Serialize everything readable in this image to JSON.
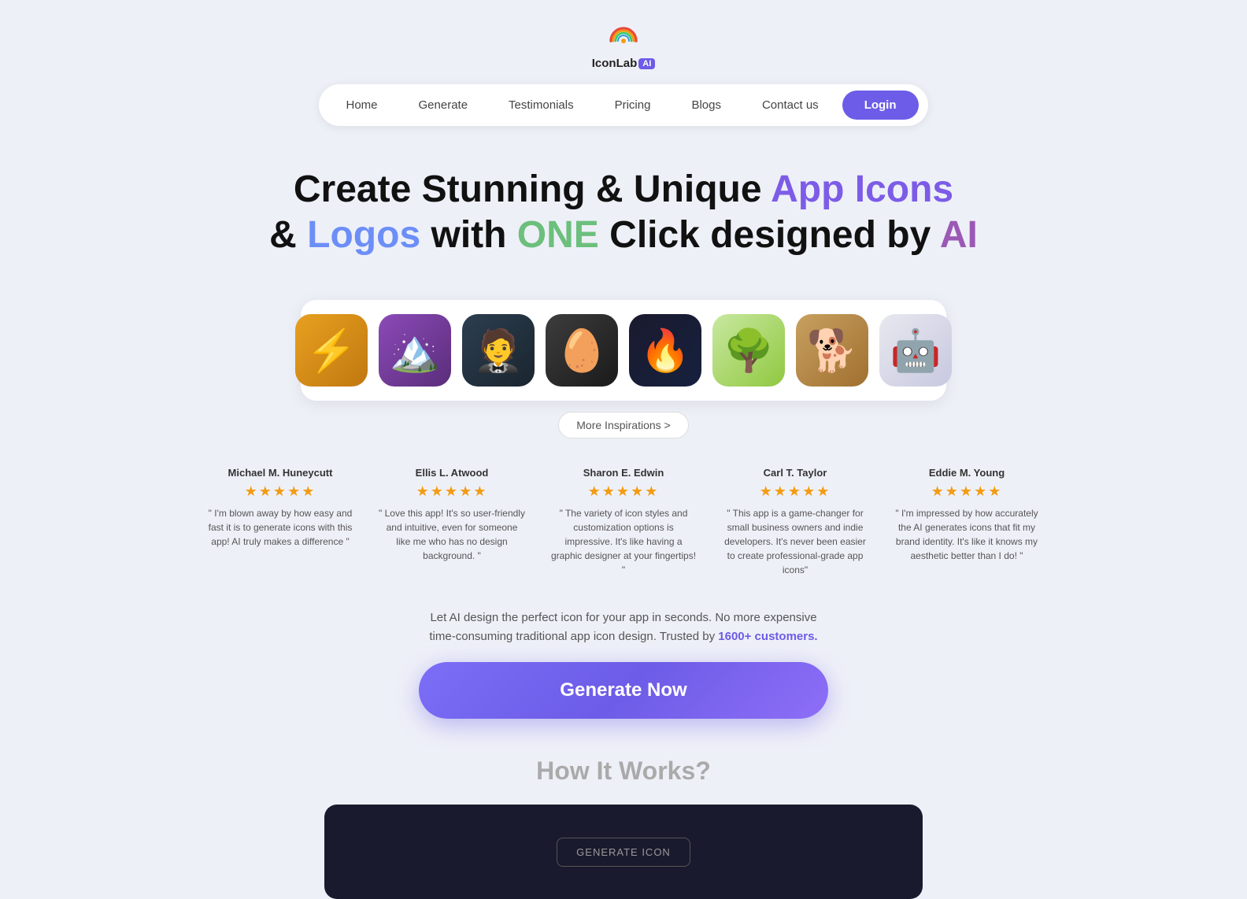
{
  "header": {
    "logo_name": "IconLab",
    "logo_badge": "AI",
    "nav": {
      "items": [
        {
          "id": "home",
          "label": "Home"
        },
        {
          "id": "generate",
          "label": "Generate"
        },
        {
          "id": "testimonials",
          "label": "Testimonials"
        },
        {
          "id": "pricing",
          "label": "Pricing"
        },
        {
          "id": "blogs",
          "label": "Blogs"
        },
        {
          "id": "contact",
          "label": "Contact us"
        }
      ],
      "login_label": "Login"
    }
  },
  "hero": {
    "title_part1": "Create Stunning & Unique ",
    "title_highlight1": "App Icons",
    "title_part2": "& ",
    "title_highlight2": "Logos",
    "title_part3": " with ",
    "title_highlight3": "ONE",
    "title_part4": " Click designed by ",
    "title_highlight4": "AI"
  },
  "icon_showcase": {
    "icons": [
      {
        "id": "icon-1",
        "emoji": "⚡",
        "label": "Pikachu icon"
      },
      {
        "id": "icon-2",
        "emoji": "🏔️",
        "label": "Mountain icon"
      },
      {
        "id": "icon-3",
        "emoji": "🤵",
        "label": "Suit icon"
      },
      {
        "id": "icon-4",
        "emoji": "🥚",
        "label": "Egg icon"
      },
      {
        "id": "icon-5",
        "emoji": "🔥",
        "label": "Fire icon"
      },
      {
        "id": "icon-6",
        "emoji": "🌳",
        "label": "Tree icon"
      },
      {
        "id": "icon-7",
        "emoji": "🐕",
        "label": "Dog icon"
      },
      {
        "id": "icon-8",
        "emoji": "🤖",
        "label": "Robot icon"
      }
    ],
    "more_button": "More Inspirations >"
  },
  "testimonials": [
    {
      "id": "t1",
      "name": "Michael M. Huneycutt",
      "stars": "★★★★★",
      "text": "\" I'm blown away by how easy and fast it is to generate icons with this app! AI truly makes a difference \""
    },
    {
      "id": "t2",
      "name": "Ellis L. Atwood",
      "stars": "★★★★★",
      "text": "\" Love this app! It's so user-friendly and intuitive, even for someone like me who has no design background. \""
    },
    {
      "id": "t3",
      "name": "Sharon E. Edwin",
      "stars": "★★★★★",
      "text": "\" The variety of icon styles and customization options is impressive. It's like having a graphic designer at your fingertips! \""
    },
    {
      "id": "t4",
      "name": "Carl T. Taylor",
      "stars": "★★★★★",
      "text": "\" This app is a game-changer for small business owners and indie developers. It's never been easier to create professional-grade app icons\""
    },
    {
      "id": "t5",
      "name": "Eddie M. Young",
      "stars": "★★★★★",
      "text": "\" I'm impressed by how accurately the AI generates icons that fit my brand identity. It's like it knows my aesthetic better than I do! \""
    }
  ],
  "cta": {
    "subtitle_part1": "Let AI design the perfect icon for your app in seconds. No more expensive",
    "subtitle_part2": "time-consuming traditional app icon design. Trusted by ",
    "subtitle_highlight": "1600+ customers.",
    "button_label": "Generate Now"
  },
  "how_it_works": {
    "title": "How It Works?",
    "generate_icon_label": "GENERATE ICON"
  }
}
